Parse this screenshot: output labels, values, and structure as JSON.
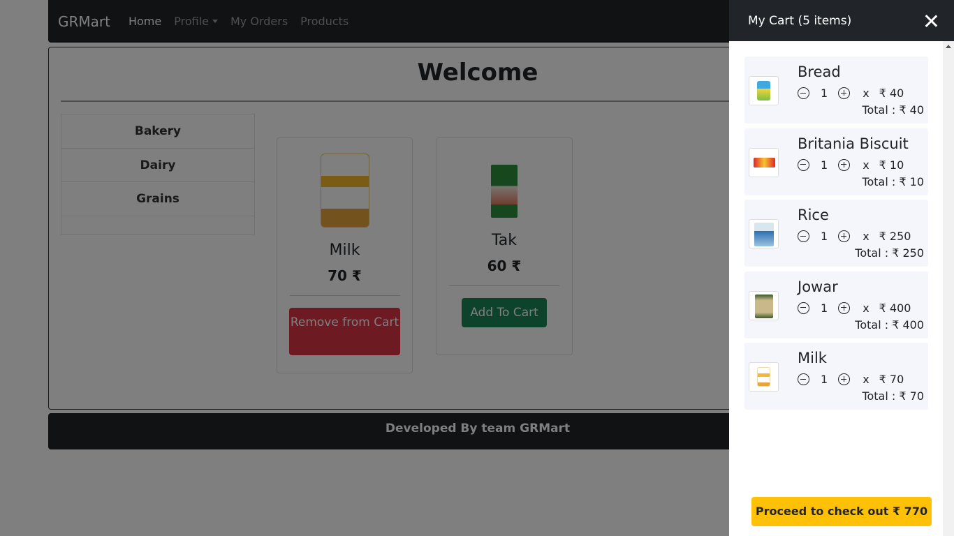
{
  "navbar": {
    "brand": "GRMart",
    "links": [
      "Home",
      "Profile",
      "My Orders",
      "Products"
    ]
  },
  "main": {
    "heading": "Welcome",
    "categories": [
      "Bakery",
      "Dairy",
      "Grains"
    ],
    "products": [
      {
        "name": "Milk",
        "price": "70 ₹",
        "button": "Remove from Cart"
      },
      {
        "name": "Tak",
        "price": "60 ₹",
        "button": "Add To Cart"
      }
    ]
  },
  "footer": {
    "text": "Developed By team GRMart"
  },
  "cart": {
    "title": "My Cart (5 items)",
    "items": [
      {
        "name": "Bread",
        "qty": "1",
        "x": "x",
        "price": "₹ 40",
        "total": "Total : ₹ 40"
      },
      {
        "name": "Britania Biscuit",
        "qty": "1",
        "x": "x",
        "price": "₹ 10",
        "total": "Total : ₹ 10"
      },
      {
        "name": "Rice",
        "qty": "1",
        "x": "x",
        "price": "₹ 250",
        "total": "Total : ₹ 250"
      },
      {
        "name": "Jowar",
        "qty": "1",
        "x": "x",
        "price": "₹ 400",
        "total": "Total : ₹ 400"
      },
      {
        "name": "Milk",
        "qty": "1",
        "x": "x",
        "price": "₹ 70",
        "total": "Total : ₹ 70"
      }
    ],
    "checkout": "Proceed to check out  ₹ 770"
  },
  "colors": {
    "navbar": "#212529",
    "danger": "#dc3545",
    "success": "#198754",
    "warning": "#ffc107",
    "cart_item_bg": "#f4f6fc"
  }
}
